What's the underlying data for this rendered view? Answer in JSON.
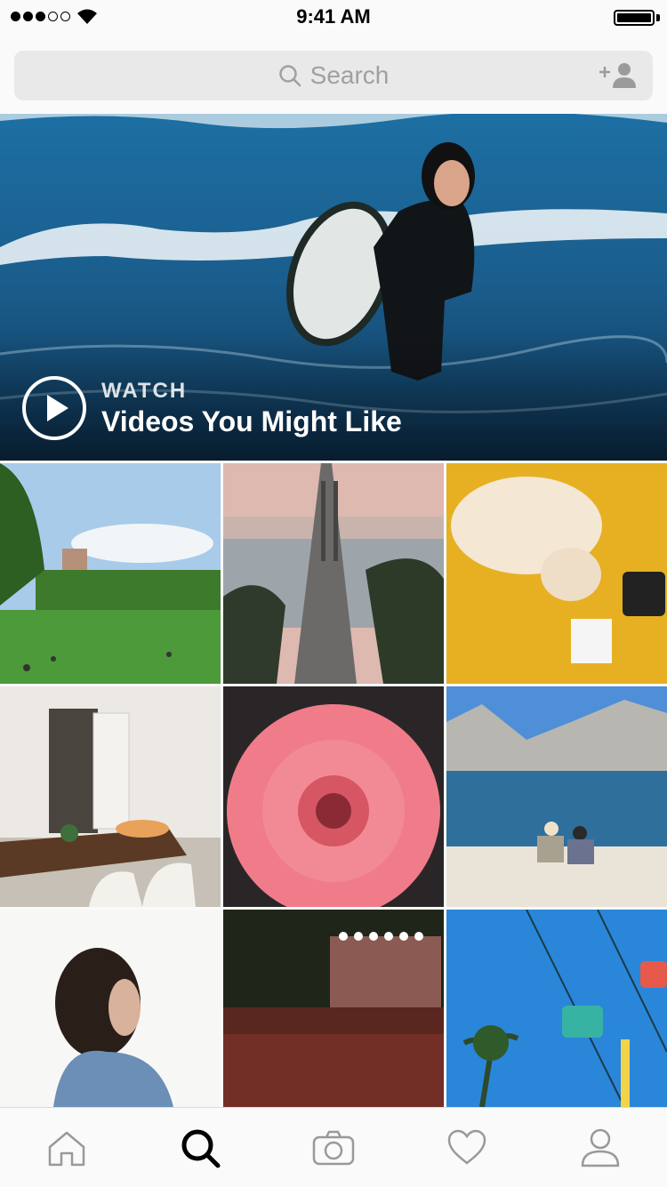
{
  "status_bar": {
    "time": "9:41 AM"
  },
  "search": {
    "placeholder": "Search"
  },
  "hero": {
    "kicker": "WATCH",
    "title": "Videos You Might Like"
  },
  "grid": {
    "tiles": [
      {
        "subject": "park-photo"
      },
      {
        "subject": "bridge-photo"
      },
      {
        "subject": "cat-photo"
      },
      {
        "subject": "dining-room-photo"
      },
      {
        "subject": "flower-photo"
      },
      {
        "subject": "lake-photo"
      },
      {
        "subject": "portrait-photo"
      },
      {
        "subject": "concert-photo"
      },
      {
        "subject": "ferris-wheel-photo"
      }
    ]
  },
  "tabbar": {
    "tabs": [
      {
        "icon": "home-icon",
        "active": false
      },
      {
        "icon": "search-icon",
        "active": true
      },
      {
        "icon": "camera-icon",
        "active": false
      },
      {
        "icon": "heart-icon",
        "active": false
      },
      {
        "icon": "profile-icon",
        "active": false
      }
    ]
  },
  "colors": {
    "background": "#fafafa",
    "search_bg": "#e9e9e9",
    "icon_gray": "#999999",
    "active": "#000000"
  }
}
